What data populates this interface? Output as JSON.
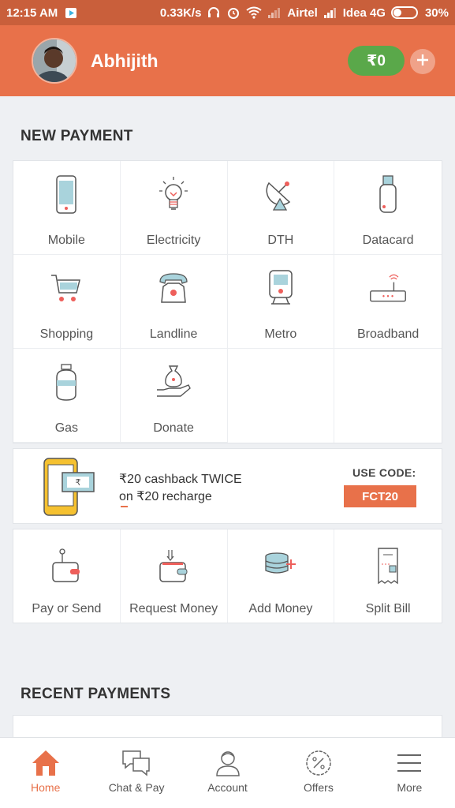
{
  "status_bar": {
    "time": "12:15 AM",
    "speed": "0.33K/s",
    "carrier1": "Airtel",
    "carrier2": "Idea 4G",
    "battery": "30%"
  },
  "header": {
    "username": "Abhijith",
    "wallet_balance": "₹0"
  },
  "new_payment": {
    "title": "NEW PAYMENT",
    "items": [
      {
        "label": "Mobile",
        "icon": "mobile-icon"
      },
      {
        "label": "Electricity",
        "icon": "bulb-icon"
      },
      {
        "label": "DTH",
        "icon": "satellite-dish-icon"
      },
      {
        "label": "Datacard",
        "icon": "usb-dongle-icon"
      },
      {
        "label": "Shopping",
        "icon": "cart-icon"
      },
      {
        "label": "Landline",
        "icon": "telephone-icon"
      },
      {
        "label": "Metro",
        "icon": "train-icon"
      },
      {
        "label": "Broadband",
        "icon": "router-icon"
      },
      {
        "label": "Gas",
        "icon": "gas-cylinder-icon"
      },
      {
        "label": "Donate",
        "icon": "donate-hand-icon"
      }
    ]
  },
  "promo": {
    "line1": "₹20 cashback TWICE",
    "line2": "on ₹20 recharge",
    "code_label": "USE CODE:",
    "code": "FCT20"
  },
  "actions": [
    {
      "label": "Pay or Send",
      "icon": "wallet-send-icon"
    },
    {
      "label": "Request Money",
      "icon": "wallet-request-icon"
    },
    {
      "label": "Add Money",
      "icon": "add-money-icon"
    },
    {
      "label": "Split Bill",
      "icon": "receipt-icon"
    }
  ],
  "recent_payments": {
    "title": "RECENT PAYMENTS"
  },
  "bottom_nav": [
    {
      "label": "Home",
      "icon": "home-icon",
      "active": true
    },
    {
      "label": "Chat & Pay",
      "icon": "chat-icon"
    },
    {
      "label": "Account",
      "icon": "user-icon"
    },
    {
      "label": "Offers",
      "icon": "offers-badge-icon"
    },
    {
      "label": "More",
      "icon": "menu-icon"
    }
  ],
  "colors": {
    "accent": "#e8714a",
    "status_bar": "#c95f3b",
    "wallet_green": "#5aa84a",
    "icon_teal": "#a9d3dc",
    "icon_red": "#ee5f5b"
  }
}
